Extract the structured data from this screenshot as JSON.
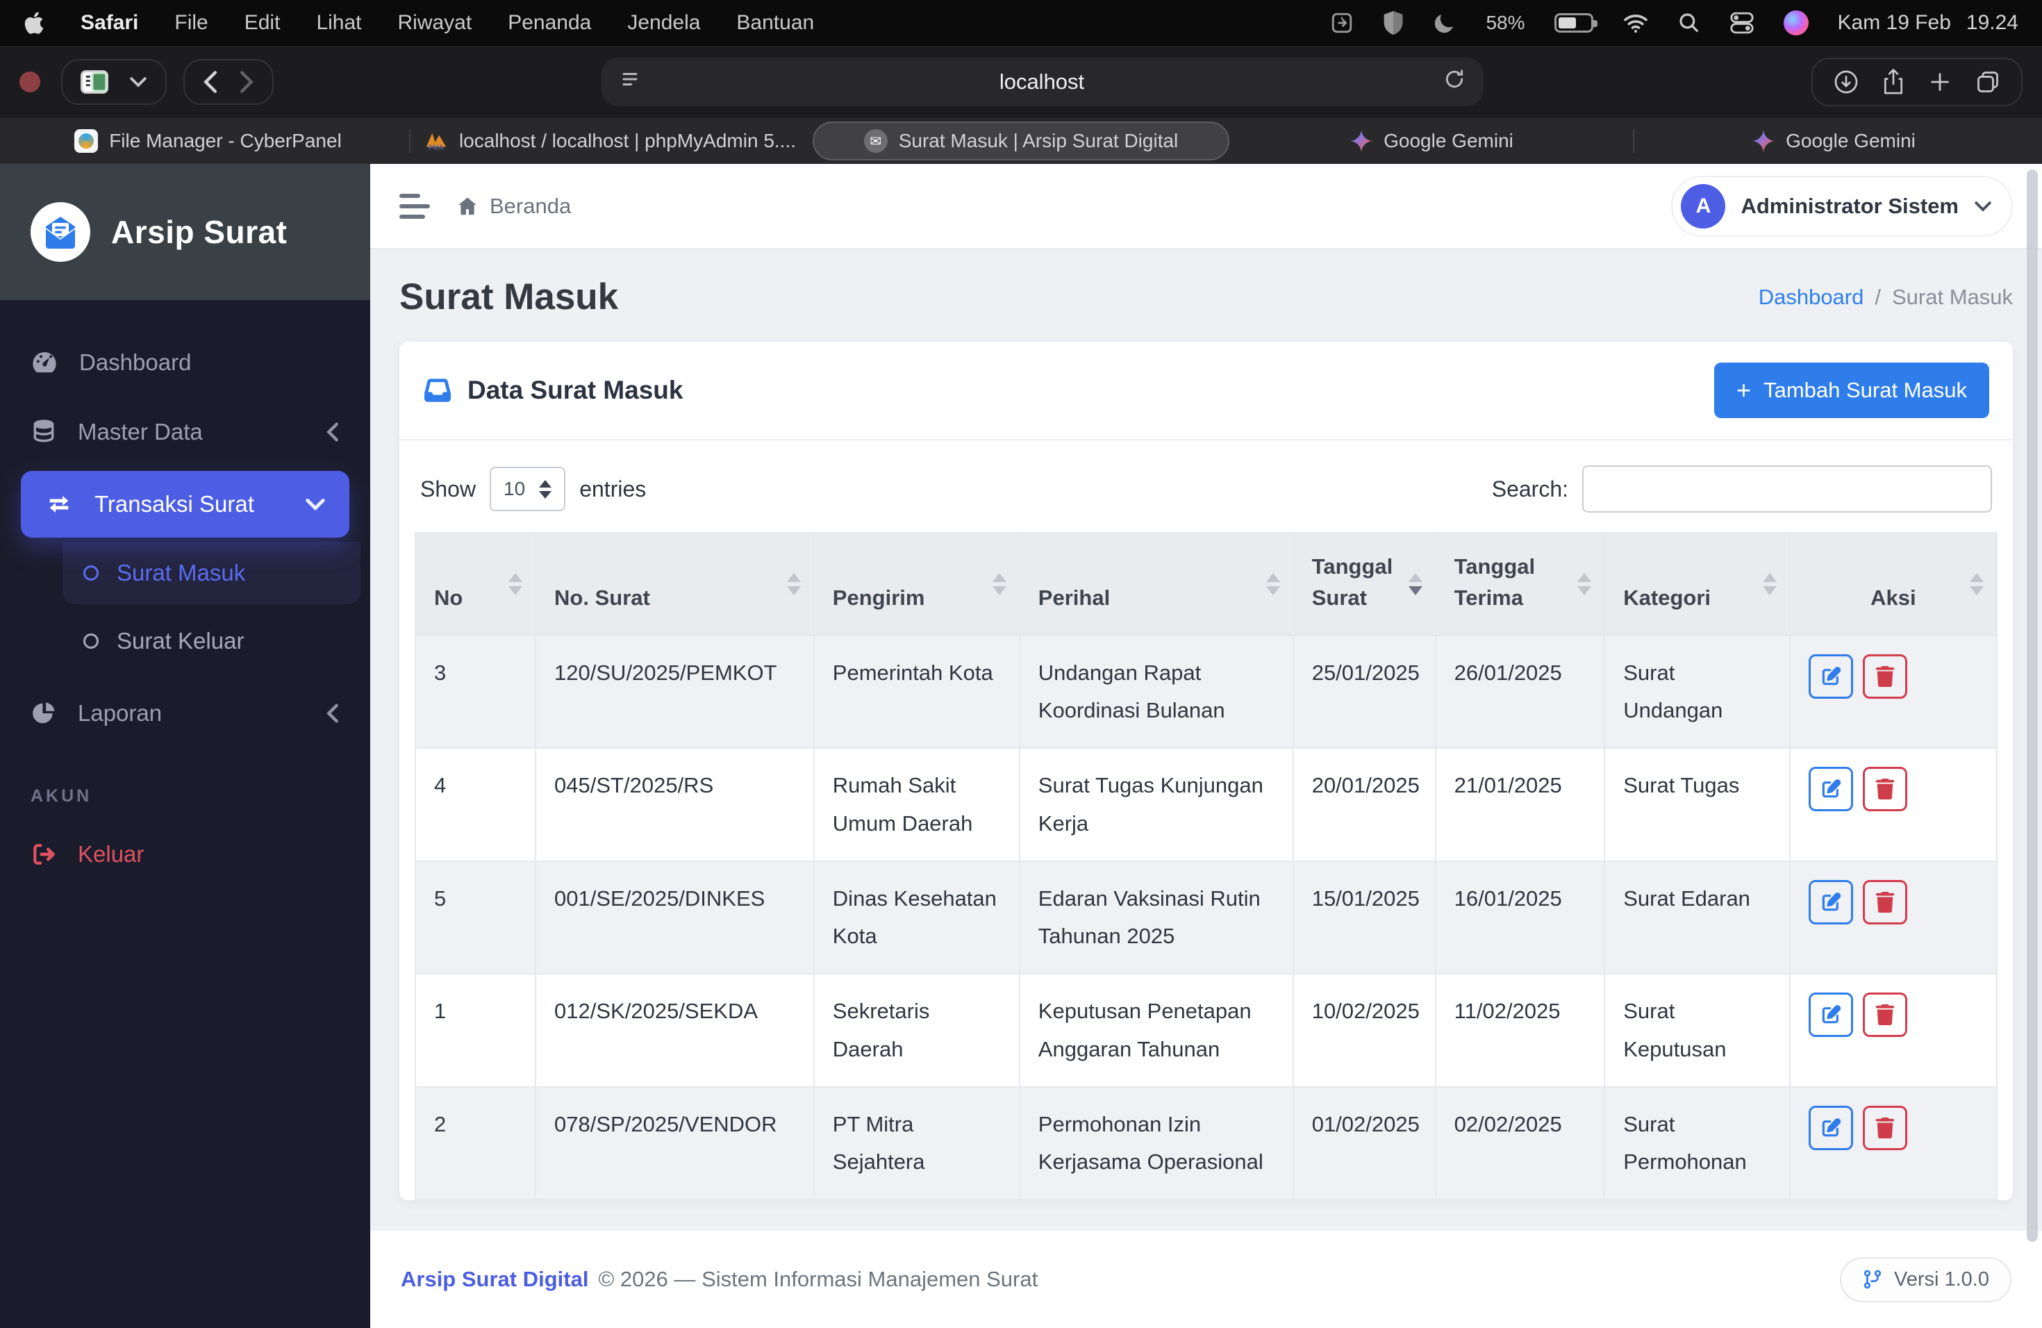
{
  "menubar": {
    "apple_menu": "",
    "items": [
      "Safari",
      "File",
      "Edit",
      "Lihat",
      "Riwayat",
      "Penanda",
      "Jendela",
      "Bantuan"
    ],
    "battery_percent": "58%",
    "date": "Kam 19 Feb",
    "time": "19.24"
  },
  "browser": {
    "url": "localhost",
    "tabs": [
      {
        "label": "File Manager - CyberPanel"
      },
      {
        "label": "localhost / localhost | phpMyAdmin 5...."
      },
      {
        "label": "Surat Masuk | Arsip Surat Digital"
      },
      {
        "label": "Google Gemini"
      },
      {
        "label": "Google Gemini"
      }
    ]
  },
  "sidebar": {
    "brand": "Arsip Surat",
    "dashboard": "Dashboard",
    "master_data": "Master Data",
    "transaksi_surat": "Transaksi Surat",
    "surat_masuk": "Surat Masuk",
    "surat_keluar": "Surat Keluar",
    "laporan": "Laporan",
    "akun_section": "AKUN",
    "keluar": "Keluar"
  },
  "topbar": {
    "breadcrumb_home": "Beranda",
    "avatar_initial": "A",
    "user_name": "Administrator Sistem"
  },
  "page": {
    "title": "Surat Masuk",
    "breadcrumb_link": "Dashboard",
    "breadcrumb_sep": "/",
    "breadcrumb_current": "Surat Masuk"
  },
  "card": {
    "title": "Data Surat Masuk",
    "add_button": "Tambah Surat Masuk",
    "show_label": "Show",
    "page_size": "10",
    "entries_label": "entries",
    "search_label": "Search:"
  },
  "table": {
    "headers": [
      "No",
      "No. Surat",
      "Pengirim",
      "Perihal",
      "Tanggal Surat",
      "Tanggal Terima",
      "Kategori",
      "Aksi"
    ],
    "rows": [
      {
        "no": "3",
        "no_surat": "120/SU/2025/PEMKOT",
        "pengirim": "Pemerintah Kota",
        "perihal": "Undangan Rapat Koordinasi Bulanan",
        "tgl_surat": "25/01/2025",
        "tgl_terima": "26/01/2025",
        "kategori": "Surat Undangan"
      },
      {
        "no": "4",
        "no_surat": "045/ST/2025/RS",
        "pengirim": "Rumah Sakit Umum Daerah",
        "perihal": "Surat Tugas Kunjungan Kerja",
        "tgl_surat": "20/01/2025",
        "tgl_terima": "21/01/2025",
        "kategori": "Surat Tugas"
      },
      {
        "no": "5",
        "no_surat": "001/SE/2025/DINKES",
        "pengirim": "Dinas Kesehatan Kota",
        "perihal": "Edaran Vaksinasi Rutin Tahunan 2025",
        "tgl_surat": "15/01/2025",
        "tgl_terima": "16/01/2025",
        "kategori": "Surat Edaran"
      },
      {
        "no": "1",
        "no_surat": "012/SK/2025/SEKDA",
        "pengirim": "Sekretaris Daerah",
        "perihal": "Keputusan Penetapan Anggaran Tahunan",
        "tgl_surat": "10/02/2025",
        "tgl_terima": "11/02/2025",
        "kategori": "Surat Keputusan"
      },
      {
        "no": "2",
        "no_surat": "078/SP/2025/VENDOR",
        "pengirim": "PT Mitra Sejahtera",
        "perihal": "Permohonan Izin Kerjasama Operasional",
        "tgl_surat": "01/02/2025",
        "tgl_terima": "02/02/2025",
        "kategori": "Surat Permohonan"
      }
    ]
  },
  "footer": {
    "brand": "Arsip Surat Digital",
    "copyright": "© 2026 — Sistem Informasi Manajemen Surat",
    "version": "Versi 1.0.0"
  },
  "colors": {
    "accent_blue": "#2f7deb",
    "sidebar_active": "#4d5de4",
    "danger_red": "#d43b4c",
    "link_blue": "#2f80ed",
    "footer_brand": "#4c5ee0"
  }
}
